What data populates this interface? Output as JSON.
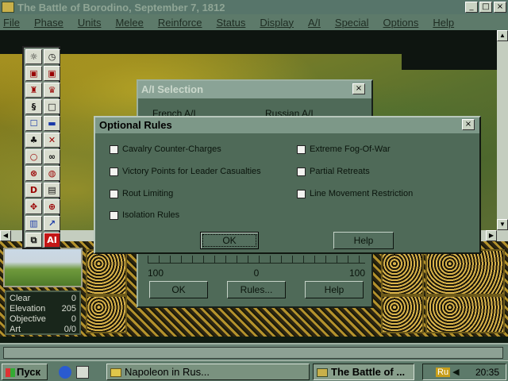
{
  "window": {
    "title": "The Battle of Borodino, September 7, 1812",
    "min": "_",
    "max": "□",
    "close": "×"
  },
  "menu": [
    "File",
    "Phase",
    "Units",
    "Melee",
    "Reinforce",
    "Status",
    "Display",
    "A/I",
    "Special",
    "Options",
    "Help"
  ],
  "toolbar": {
    "buttons": [
      "☼",
      "◷",
      "▣",
      "▣",
      "♜",
      "♛",
      "§",
      "□",
      "☐",
      "▬",
      "♣",
      "✕",
      "○",
      "∞",
      "⊗",
      "◍",
      "D",
      "▤",
      "✥",
      "⊕",
      "▥",
      "↗",
      "⧉",
      "AI"
    ]
  },
  "ai_dialog": {
    "title": "A/I Selection",
    "french_label": "French A/I",
    "russian_label": "Russian A/I",
    "scale_left": "100",
    "scale_mid": "0",
    "scale_right": "100",
    "ok": "OK",
    "rules": "Rules...",
    "help": "Help"
  },
  "optional_rules": {
    "title": "Optional Rules",
    "close": "×",
    "left_options": [
      "Cavalry Counter-Charges",
      "Victory Points for Leader Casualties",
      "Rout Limiting",
      "Isolation Rules"
    ],
    "right_options": [
      "Extreme Fog-Of-War",
      "Partial Retreats",
      "Line Movement Restriction"
    ],
    "ok": "OK",
    "help": "Help"
  },
  "terrain_info": [
    {
      "label": "Clear",
      "value": "0"
    },
    {
      "label": "Elevation",
      "value": "205"
    },
    {
      "label": "Objective",
      "value": "0"
    },
    {
      "label": "Art",
      "value": "0/0"
    }
  ],
  "taskbar": {
    "start": "Пуск",
    "task1": "Napoleon in Rus...",
    "task2": "The Battle of ...",
    "lang": "Ru",
    "clock": "20:35"
  },
  "colors": {
    "dialog_bg": "#4f6a58",
    "title_bg": "#57756a"
  }
}
